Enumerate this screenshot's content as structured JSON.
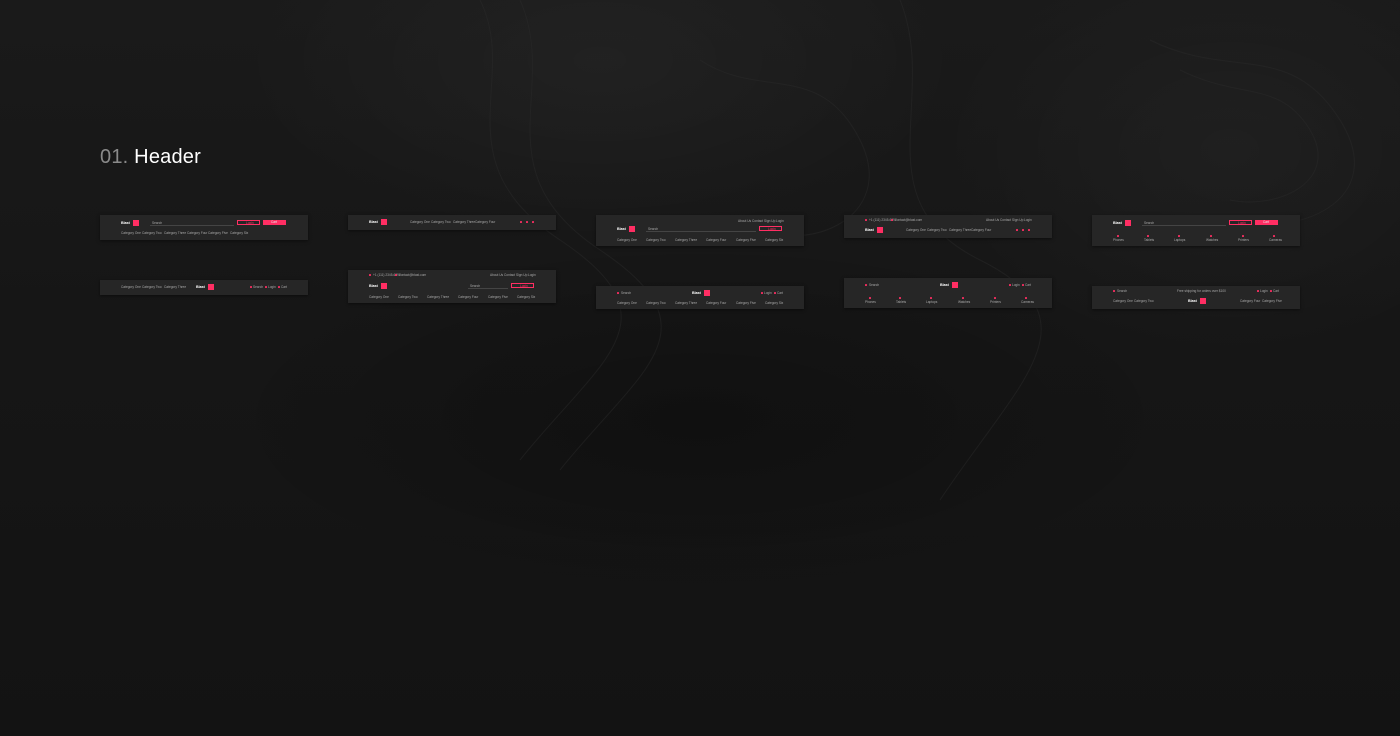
{
  "section": {
    "number": "01.",
    "title": "Header"
  },
  "brand": {
    "name": "Blast",
    "accent": "#ff2e63"
  },
  "categories": [
    "Category One",
    "Category Two",
    "Category Three",
    "Category Four",
    "Category Five",
    "Category Six"
  ],
  "cat_icons": [
    "Phones",
    "Tablets",
    "Laptops",
    "Watches",
    "Printers",
    "Cameras"
  ],
  "contact": {
    "phone": "+1 (111) 2345-6897",
    "email": "contact@blast.com"
  },
  "links": [
    "About Us",
    "Contact",
    "Sign Up",
    "Login"
  ],
  "search": {
    "placeholder": "Search",
    "label": "Search"
  },
  "actions": {
    "login": "Login",
    "cart": "Cart",
    "wish": "Wish"
  },
  "promo": "Free shipping for orders over $100"
}
